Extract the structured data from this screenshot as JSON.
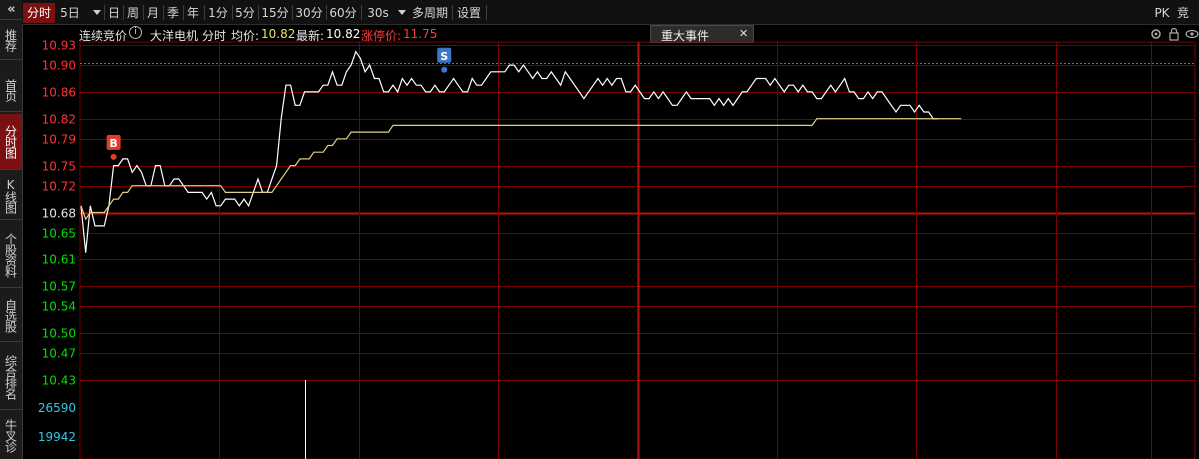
{
  "sidebar": {
    "collapse_icon": "double-chevron-left",
    "items": [
      {
        "label": "推荐",
        "active": false
      },
      {
        "label": "首页",
        "active": false
      },
      {
        "label": "分时图",
        "active": true
      },
      {
        "label": "K线图",
        "active": false
      },
      {
        "label": "个股资料",
        "active": false
      },
      {
        "label": "自选股",
        "active": false
      },
      {
        "label": "综合排名",
        "active": false
      },
      {
        "label": "牛叉诊",
        "active": false
      }
    ]
  },
  "toolbar": {
    "periods": [
      "分时",
      "5日",
      "日",
      "周",
      "月",
      "季",
      "年",
      "1分",
      "5分",
      "15分",
      "30分",
      "60分",
      "30s",
      "多周期",
      "设置"
    ],
    "active_period": "分时",
    "right_items": [
      "PK",
      "竞"
    ]
  },
  "info": {
    "auction_label": "连续竞价",
    "info_icon": "info-circle-icon",
    "stock_name": "大洋电机",
    "view_name": "分时",
    "avg_label": "均价:",
    "avg_value": "10.82",
    "latest_label": "最新:",
    "latest_value": "10.82",
    "limit_label": "涨停价:",
    "limit_value": "11.75",
    "events_tab": "重大事件",
    "events_close": "✕"
  },
  "colors": {
    "up": "#ff3232",
    "down": "#00e000",
    "grid": "#7a0000",
    "price_line": "#ffffff",
    "avg_line": "#e0d080",
    "buy_marker": "#e03c28",
    "sell_marker": "#3c78c8"
  },
  "chart_data": {
    "type": "line",
    "prev_close": 10.68,
    "y_ticks": [
      "10.93",
      "10.90",
      "10.86",
      "10.82",
      "10.79",
      "10.75",
      "10.72",
      "10.68",
      "10.65",
      "10.61",
      "10.57",
      "10.54",
      "10.50",
      "10.47",
      "10.43"
    ],
    "volume_ticks": [
      "26590",
      "19942"
    ],
    "ylim": [
      10.43,
      10.93
    ],
    "series": [
      {
        "values": [
          10.69,
          10.62,
          10.69,
          10.66,
          10.66,
          10.66,
          10.69,
          10.75,
          10.75,
          10.76,
          10.76,
          10.74,
          10.75,
          10.74,
          10.72,
          10.72,
          10.75,
          10.75,
          10.72,
          10.72,
          10.73,
          10.73,
          10.72,
          10.71,
          10.71,
          10.71,
          10.71,
          10.7,
          10.71,
          10.69,
          10.69,
          10.7,
          10.7,
          10.7,
          10.69,
          10.7,
          10.69,
          10.71,
          10.73,
          10.71,
          10.71,
          10.73,
          10.75,
          10.82,
          10.87,
          10.87,
          10.84,
          10.84,
          10.86,
          10.86,
          10.86,
          10.86,
          10.87,
          10.87,
          10.89,
          10.87,
          10.87,
          10.89,
          10.9,
          10.92,
          10.91,
          10.89,
          10.9,
          10.88,
          10.88,
          10.86,
          10.86,
          10.87,
          10.86,
          10.88,
          10.87,
          10.88,
          10.87,
          10.87,
          10.86,
          10.86,
          10.87,
          10.86,
          10.86,
          10.87,
          10.88,
          10.87,
          10.86,
          10.86,
          10.88,
          10.87,
          10.87,
          10.88,
          10.89,
          10.89,
          10.89,
          10.89,
          10.9,
          10.9,
          10.89,
          10.9,
          10.89,
          10.88,
          10.89,
          10.88,
          10.88,
          10.89,
          10.88,
          10.87,
          10.89,
          10.88,
          10.87,
          10.86,
          10.85,
          10.86,
          10.87,
          10.88,
          10.87,
          10.88,
          10.87,
          10.88,
          10.88,
          10.86,
          10.86,
          10.87,
          10.86,
          10.85,
          10.85,
          10.86,
          10.85,
          10.86,
          10.85,
          10.84,
          10.84,
          10.85,
          10.86,
          10.85,
          10.85,
          10.85,
          10.85,
          10.85,
          10.84,
          10.85,
          10.84,
          10.85,
          10.84,
          10.85,
          10.86,
          10.86,
          10.87,
          10.88,
          10.88,
          10.88,
          10.87,
          10.88,
          10.87,
          10.86,
          10.87,
          10.87,
          10.86,
          10.87,
          10.86,
          10.86,
          10.85,
          10.85,
          10.86,
          10.87,
          10.86,
          10.87,
          10.88,
          10.86,
          10.86,
          10.85,
          10.85,
          10.86,
          10.85,
          10.86,
          10.86,
          10.85,
          10.84,
          10.83,
          10.84,
          10.84,
          10.84,
          10.83,
          10.84,
          10.83,
          10.83,
          10.82,
          10.82
        ]
      },
      {
        "values": [
          10.69,
          10.67,
          10.68,
          10.68,
          10.68,
          10.68,
          10.69,
          10.7,
          10.7,
          10.71,
          10.71,
          10.72,
          10.72,
          10.72,
          10.72,
          10.72,
          10.72,
          10.72,
          10.72,
          10.72,
          10.72,
          10.72,
          10.72,
          10.72,
          10.72,
          10.72,
          10.72,
          10.72,
          10.72,
          10.72,
          10.72,
          10.71,
          10.71,
          10.71,
          10.71,
          10.71,
          10.71,
          10.71,
          10.71,
          10.71,
          10.71,
          10.71,
          10.72,
          10.73,
          10.74,
          10.75,
          10.75,
          10.76,
          10.76,
          10.76,
          10.77,
          10.77,
          10.77,
          10.78,
          10.78,
          10.79,
          10.79,
          10.79,
          10.8,
          10.8,
          10.8,
          10.8,
          10.8,
          10.8,
          10.8,
          10.8,
          10.8,
          10.81,
          10.81,
          10.81,
          10.81,
          10.81,
          10.81,
          10.81,
          10.81,
          10.81,
          10.81,
          10.81,
          10.81,
          10.81,
          10.81,
          10.81,
          10.81,
          10.81,
          10.81,
          10.81,
          10.81,
          10.81,
          10.81,
          10.81,
          10.81,
          10.81,
          10.81,
          10.81,
          10.81,
          10.81,
          10.81,
          10.81,
          10.81,
          10.81,
          10.81,
          10.81,
          10.81,
          10.81,
          10.81,
          10.81,
          10.81,
          10.81,
          10.81,
          10.81,
          10.81,
          10.81,
          10.81,
          10.81,
          10.81,
          10.81,
          10.81,
          10.81,
          10.81,
          10.81,
          10.81,
          10.81,
          10.81,
          10.81,
          10.81,
          10.81,
          10.81,
          10.81,
          10.81,
          10.81,
          10.81,
          10.81,
          10.81,
          10.81,
          10.81,
          10.81,
          10.81,
          10.81,
          10.81,
          10.81,
          10.81,
          10.81,
          10.81,
          10.81,
          10.81,
          10.81,
          10.81,
          10.81,
          10.81,
          10.81,
          10.81,
          10.81,
          10.81,
          10.81,
          10.81,
          10.81,
          10.81,
          10.81,
          10.82,
          10.82,
          10.82,
          10.82,
          10.82,
          10.82,
          10.82,
          10.82,
          10.82,
          10.82,
          10.82,
          10.82,
          10.82,
          10.82,
          10.82,
          10.82,
          10.82,
          10.82,
          10.82,
          10.82,
          10.82,
          10.82,
          10.82,
          10.82,
          10.82,
          10.82,
          10.82,
          10.82,
          10.82,
          10.82,
          10.82,
          10.82
        ]
      }
    ],
    "markers": [
      {
        "label": "B",
        "index": 7,
        "value": 10.76
      },
      {
        "label": "S",
        "index": 78,
        "value": 10.89
      }
    ],
    "volume_spike_index": 48
  }
}
